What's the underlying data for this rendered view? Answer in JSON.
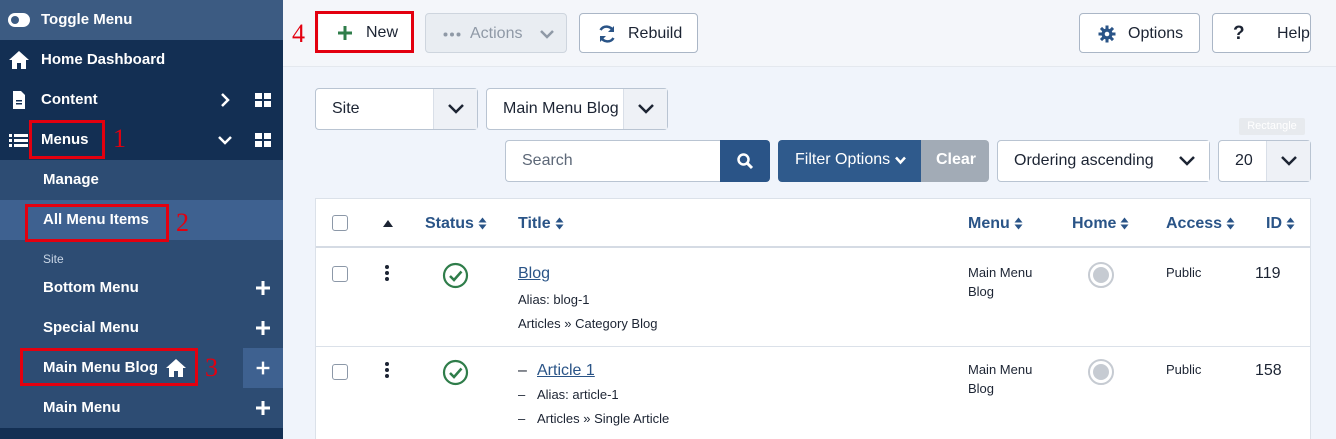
{
  "sidebar": {
    "toggle": "Toggle Menu",
    "home": "Home Dashboard",
    "content": "Content",
    "menus": "Menus",
    "manage": "Manage",
    "all_items": "All Menu Items",
    "site_label": "Site",
    "bottom_menu": "Bottom Menu",
    "special_menu": "Special Menu",
    "main_menu_blog": "Main Menu Blog",
    "main_menu": "Main Menu"
  },
  "annotations": [
    "1",
    "2",
    "3",
    "4"
  ],
  "toolbar": {
    "new": "New",
    "actions": "Actions",
    "rebuild": "Rebuild",
    "options": "Options",
    "help": "Help"
  },
  "filters": {
    "site": "Site",
    "menu": "Main Menu Blog",
    "search_placeholder": "Search",
    "filter_options": "Filter Options",
    "clear": "Clear",
    "ordering": "Ordering ascending",
    "limit": "20",
    "rect_tag": "Rectangle"
  },
  "table": {
    "headers": {
      "status": "Status",
      "title": "Title",
      "menu": "Menu",
      "home": "Home",
      "access": "Access",
      "id": "ID"
    },
    "rows": [
      {
        "title": "Blog",
        "alias": "Alias: blog-1",
        "type": "Articles » Category Blog",
        "menu": "Main Menu Blog",
        "access": "Public",
        "id": "119",
        "published": true
      },
      {
        "prefix": "–",
        "title": "Article 1",
        "alias": "Alias: article-1",
        "type": "Articles » Single Article",
        "menu": "Main Menu Blog",
        "access": "Public",
        "id": "158",
        "published": true
      }
    ]
  },
  "colors": {
    "sidebar_bg": "#132f53",
    "accent": "#2a5487",
    "annotation": "#e3000f",
    "published": "#2f7d4a"
  }
}
